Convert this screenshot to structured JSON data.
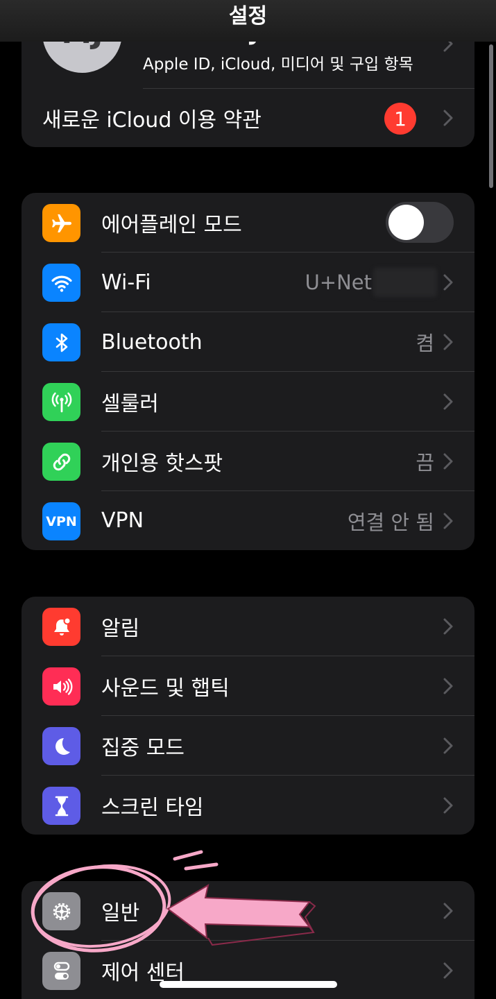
{
  "header": {
    "title": "설정"
  },
  "account": {
    "initials": "MJ",
    "name": "Munbae Joon",
    "subtitle": "Apple ID, iCloud, 미디어 및 구입 항목",
    "terms_label": "새로운 iCloud 이용 약관",
    "terms_badge": "1"
  },
  "connectivity": {
    "airplane": {
      "label": "에어플레인 모드",
      "toggle_on": false
    },
    "wifi": {
      "label": "Wi-Fi",
      "value": "U+Net"
    },
    "bluetooth": {
      "label": "Bluetooth",
      "value": "켬"
    },
    "cellular": {
      "label": "셀룰러"
    },
    "hotspot": {
      "label": "개인용 핫스팟",
      "value": "끔"
    },
    "vpn": {
      "label": "VPN",
      "icon_text": "VPN",
      "value": "연결 안 됨"
    }
  },
  "notifications_group": {
    "notifications": {
      "label": "알림"
    },
    "sounds": {
      "label": "사운드 및 햅틱"
    },
    "focus": {
      "label": "집중 모드"
    },
    "screen_time": {
      "label": "스크린 타임"
    }
  },
  "general_group": {
    "general": {
      "label": "일반"
    },
    "control_center": {
      "label": "제어 센터"
    }
  },
  "colors": {
    "airplane": "#ff9500",
    "wifi": "#0a84ff",
    "bluetooth": "#0a84ff",
    "cellular": "#30d158",
    "hotspot": "#30d158",
    "vpn": "#0a84ff",
    "notifications": "#ff3b30",
    "sounds": "#ff2d55",
    "focus": "#5e5ce6",
    "screen_time": "#5e5ce6",
    "general": "#8e8e93",
    "control_center": "#8e8e93",
    "annotation": "#f7a8c8"
  }
}
